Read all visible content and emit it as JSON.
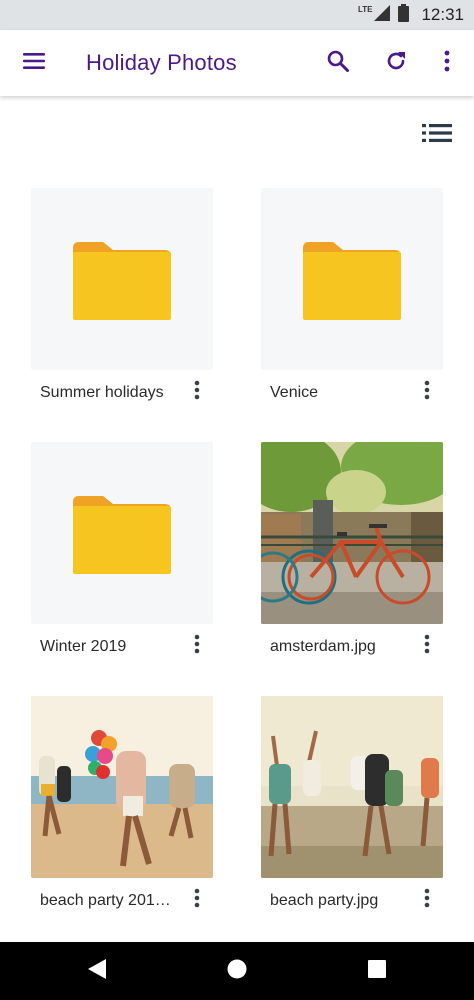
{
  "status_bar": {
    "network": "LTE",
    "time": "12:31"
  },
  "app_bar": {
    "title": "Holiday Photos"
  },
  "items": [
    {
      "name": "Summer holidays",
      "kind": "folder"
    },
    {
      "name": "Venice",
      "kind": "folder"
    },
    {
      "name": "Winter 2019",
      "kind": "folder"
    },
    {
      "name": "amsterdam.jpg",
      "kind": "image"
    },
    {
      "name": "beach party 201…",
      "kind": "image"
    },
    {
      "name": "beach party.jpg",
      "kind": "image"
    }
  ],
  "colors": {
    "accent": "#4a1a8a",
    "folder": "#f7c520",
    "folder_tab": "#f0a224"
  },
  "icons": [
    "menu-icon",
    "search-icon",
    "refresh-icon",
    "more-vert-icon",
    "list-view-icon",
    "folder-icon",
    "back-icon",
    "home-icon",
    "recents-icon"
  ]
}
